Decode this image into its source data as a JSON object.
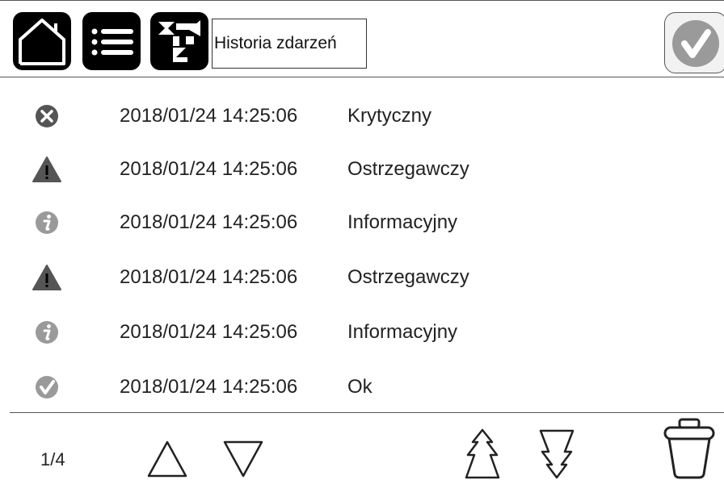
{
  "header": {
    "title": "Historia zdarzeń",
    "buttons": [
      {
        "name": "home",
        "icon": "home-icon"
      },
      {
        "name": "menu",
        "icon": "menu-icon"
      },
      {
        "name": "mimic",
        "icon": "mimic-diagram-icon"
      }
    ],
    "status_icon": "check-circle-icon"
  },
  "events": [
    {
      "icon": "error-x-icon",
      "timestamp": "2018/01/24 14:25:06",
      "level": "Krytyczny"
    },
    {
      "icon": "warning-triangle-icon",
      "timestamp": "2018/01/24 14:25:06",
      "level": "Ostrzegawczy"
    },
    {
      "icon": "info-icon",
      "timestamp": "2018/01/24 14:25:06",
      "level": "Informacyjny"
    },
    {
      "icon": "warning-triangle-icon",
      "timestamp": "2018/01/24 14:25:06",
      "level": "Ostrzegawczy"
    },
    {
      "icon": "info-icon",
      "timestamp": "2018/01/24 14:25:06",
      "level": "Informacyjny"
    },
    {
      "icon": "ok-check-icon",
      "timestamp": "2018/01/24 14:25:06",
      "level": "Ok"
    }
  ],
  "footer": {
    "page_indicator": "1/4",
    "controls": [
      "scroll-up-icon",
      "scroll-down-icon",
      "page-up-icon",
      "page-down-icon",
      "trash-icon"
    ]
  },
  "colors": {
    "icon_dark": "#555555",
    "icon_light": "#9a9a9a",
    "button_bg": "#000000"
  }
}
